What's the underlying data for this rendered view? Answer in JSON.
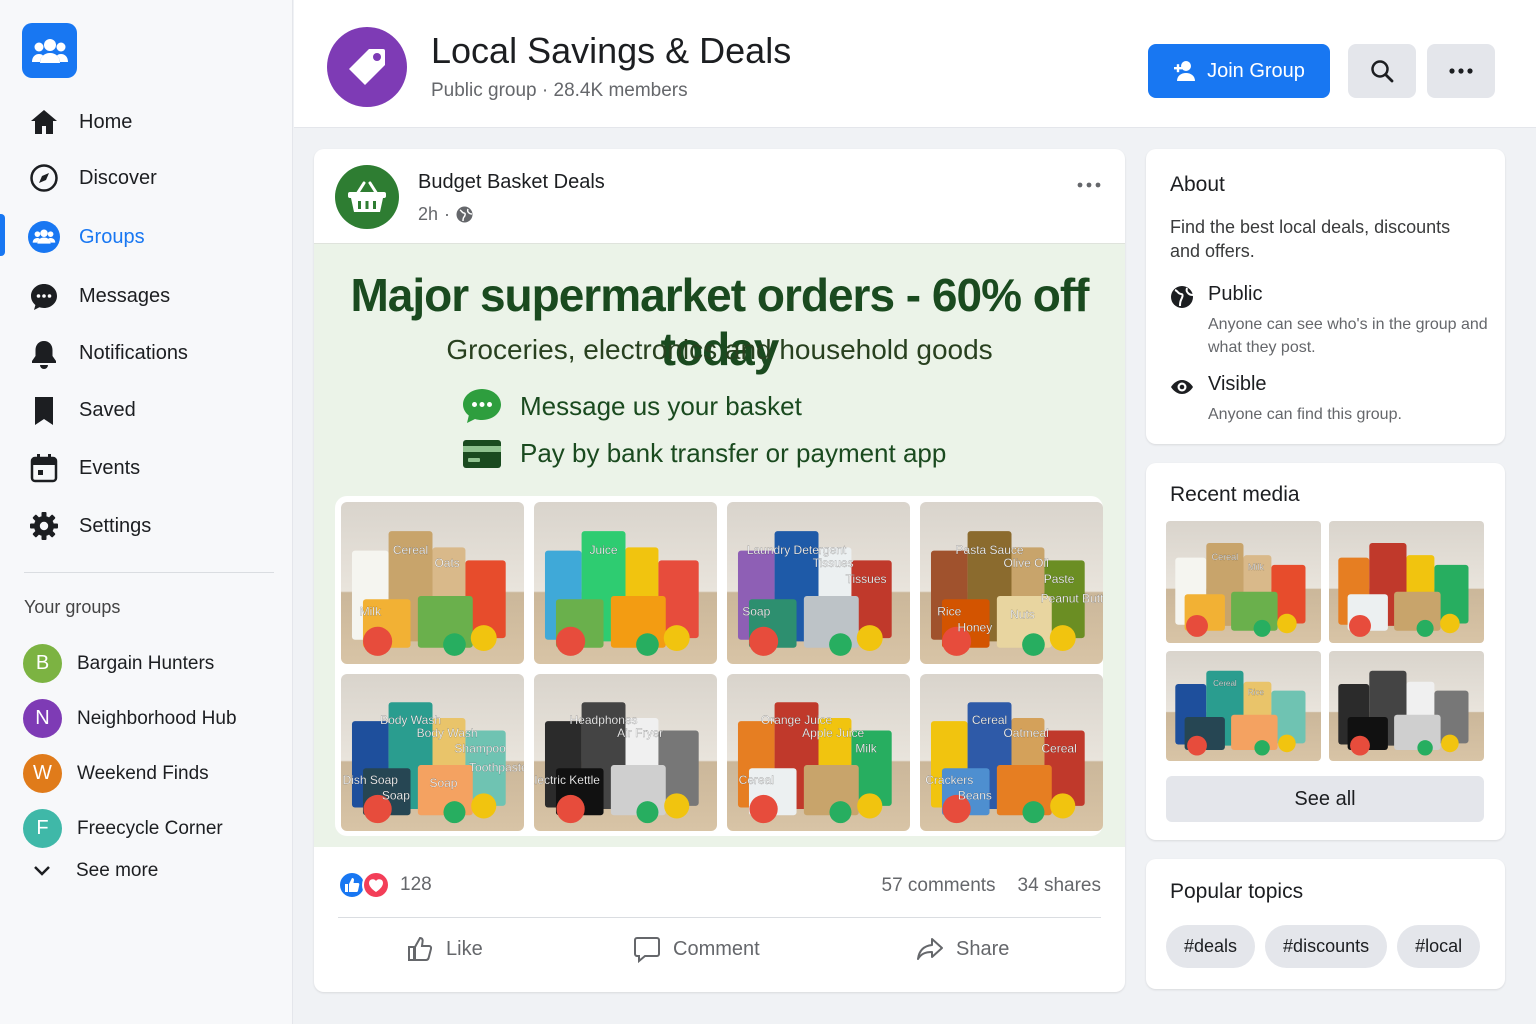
{
  "sidebar": {
    "nav": [
      {
        "label": "Home",
        "icon": "home-icon"
      },
      {
        "label": "Discover",
        "icon": "compass-icon"
      },
      {
        "label": "Groups",
        "icon": "groups-icon",
        "active": true
      },
      {
        "label": "Messages",
        "icon": "chat-icon"
      },
      {
        "label": "Notifications",
        "icon": "bell-icon"
      },
      {
        "label": "Saved",
        "icon": "bookmark-icon"
      },
      {
        "label": "Events",
        "icon": "calendar-icon"
      },
      {
        "label": "Settings",
        "icon": "gear-icon"
      }
    ],
    "your_groups_heading": "Your groups",
    "groups": [
      {
        "initial": "B",
        "label": "Bargain Hunters",
        "color": "#7cb342"
      },
      {
        "initial": "N",
        "label": "Neighborhood Hub",
        "color": "#7e3bb5"
      },
      {
        "initial": "W",
        "label": "Weekend Finds",
        "color": "#e07b1a"
      },
      {
        "initial": "F",
        "label": "Freecycle Corner",
        "color": "#3fb8a8"
      }
    ],
    "see_more": "See more"
  },
  "header": {
    "title": "Local Savings & Deals",
    "privacy": "Public group",
    "members": "28.4K members",
    "join_label": "Join Group"
  },
  "post": {
    "author": "Budget Basket Deals",
    "time": "2h",
    "image": {
      "headline": "Major supermarket orders - 60% off today",
      "subline": "Groceries, electronics and household goods",
      "line1": "Message us your basket",
      "line2": "Pay by bank transfer or payment app",
      "tile_labels": [
        [
          "Cereal",
          "Oats",
          "Milk"
        ],
        [
          "Juice"
        ],
        [
          "Laundry Detergent",
          "Tissues",
          "Soap",
          "Tissues"
        ],
        [
          "Pasta Sauce",
          "Olive Oil",
          "Rice",
          "Paste",
          "Honey",
          "Nuts",
          "Peanut Butter"
        ],
        [
          "Body Wash",
          "Body Wash",
          "Dish Soap",
          "Shampoo",
          "Soap",
          "Soap",
          "Toothpaste"
        ],
        [
          "Headphones",
          "Air Fryer",
          "Electric Kettle"
        ],
        [
          "Orange Juice",
          "Apple Juice",
          "Cereal",
          "Milk"
        ],
        [
          "Cereal",
          "Oatmeal",
          "Crackers",
          "Cereal",
          "Beans"
        ]
      ]
    },
    "reaction_count": "128",
    "comments": "57 comments",
    "shares": "34 shares",
    "actions": {
      "like": "Like",
      "comment": "Comment",
      "share": "Share"
    }
  },
  "about": {
    "title": "About",
    "description": "Find the best local deals, discounts and offers.",
    "public_title": "Public",
    "public_desc": "Anyone can see who's in the group and what they post.",
    "visible_title": "Visible",
    "visible_desc": "Anyone can find this group."
  },
  "media": {
    "title": "Recent media",
    "tile_labels": [
      [
        "Cereal",
        "Milk"
      ],
      [],
      [
        "Cereal",
        "Rice"
      ],
      []
    ],
    "see_all": "See all"
  },
  "topics": {
    "title": "Popular topics",
    "items": [
      "#deals",
      "#discounts",
      "#local"
    ]
  },
  "colors": {
    "accent": "#1877f2",
    "group_avatar": "#7e3bb5",
    "page_avatar": "#2e7d32",
    "promo_text": "#1a4a1f"
  }
}
